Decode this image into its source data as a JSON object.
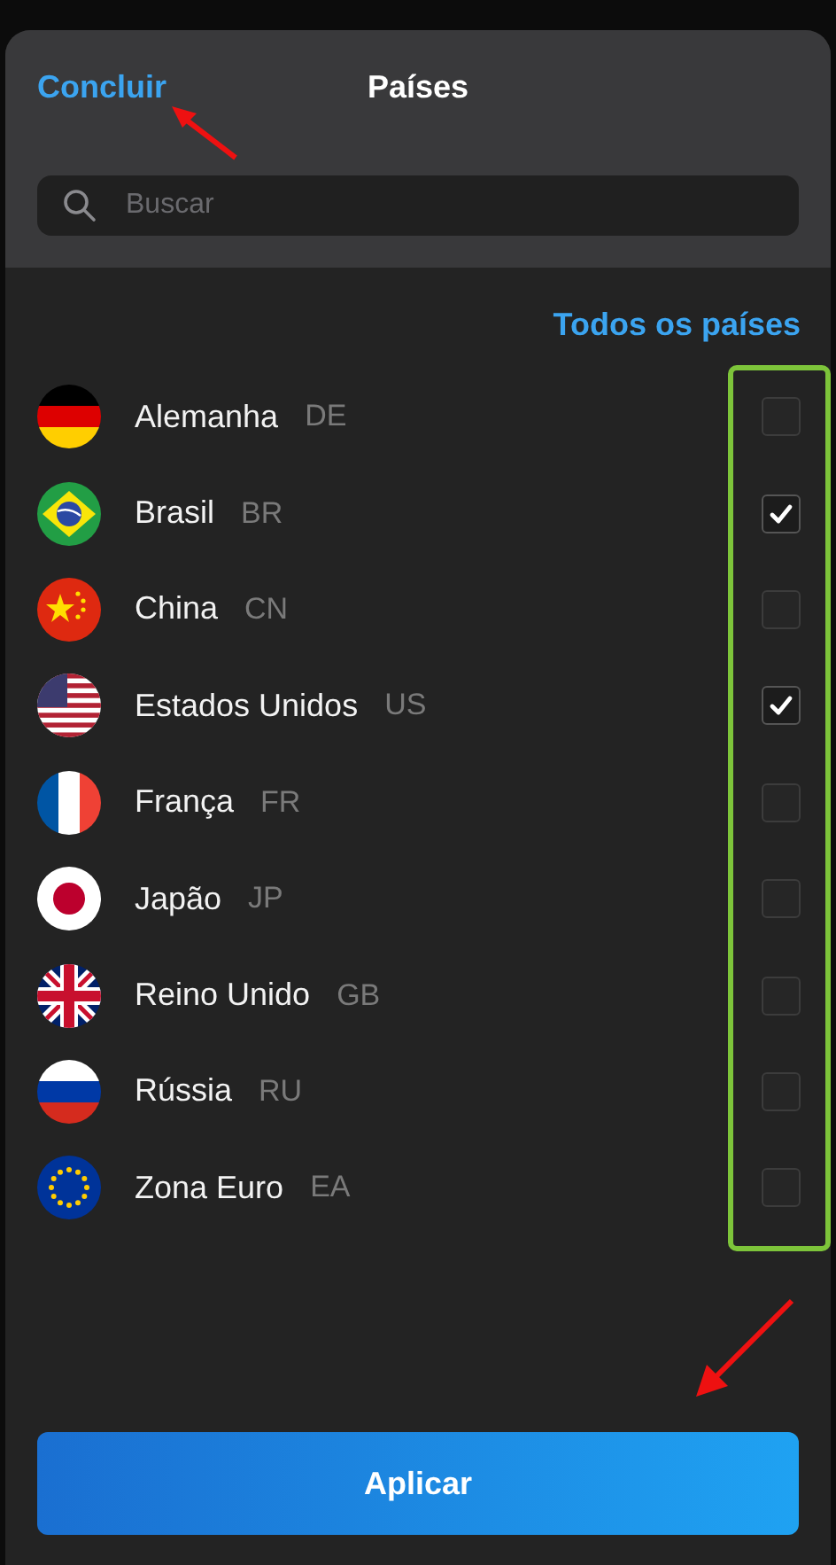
{
  "header": {
    "done": "Concluir",
    "title": "Países"
  },
  "search": {
    "placeholder": "Buscar"
  },
  "select_all": "Todos os países",
  "countries": [
    {
      "kind": "germany",
      "name": "Alemanha",
      "code": "DE",
      "checked": false
    },
    {
      "kind": "brazil",
      "name": "Brasil",
      "code": "BR",
      "checked": true
    },
    {
      "kind": "china",
      "name": "China",
      "code": "CN",
      "checked": false
    },
    {
      "kind": "usa",
      "name": "Estados Unidos",
      "code": "US",
      "checked": true
    },
    {
      "kind": "france",
      "name": "França",
      "code": "FR",
      "checked": false
    },
    {
      "kind": "japan",
      "name": "Japão",
      "code": "JP",
      "checked": false
    },
    {
      "kind": "uk",
      "name": "Reino Unido",
      "code": "GB",
      "checked": false
    },
    {
      "kind": "russia",
      "name": "Rússia",
      "code": "RU",
      "checked": false
    },
    {
      "kind": "euro",
      "name": "Zona Euro",
      "code": "EA",
      "checked": false
    }
  ],
  "apply": "Aplicar"
}
